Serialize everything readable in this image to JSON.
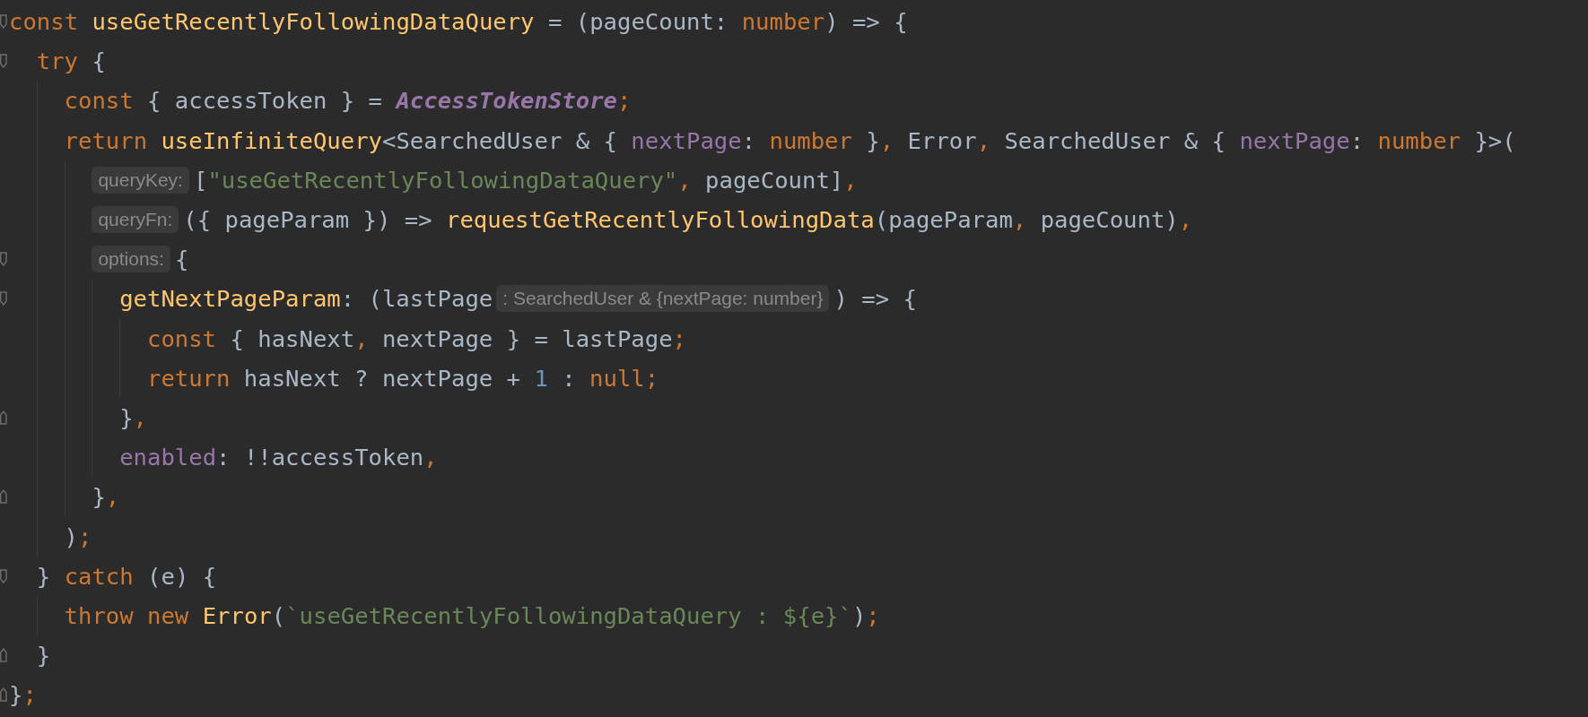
{
  "editor": {
    "lines": [
      {
        "fold_start": true,
        "tokens": [
          {
            "kind": "keyword",
            "text": "const "
          },
          {
            "kind": "function",
            "text": "useGetRecentlyFollowingDataQuery"
          },
          {
            "kind": "plain",
            "text": " = (pageCount: "
          },
          {
            "kind": "keyword",
            "text": "number"
          },
          {
            "kind": "plain",
            "text": ") => {"
          }
        ],
        "children": [
          {
            "fold_start": true,
            "tokens": [
              {
                "kind": "keyword",
                "text": "try"
              },
              {
                "kind": "plain",
                "text": " {"
              }
            ],
            "children": [
              {
                "tokens": [
                  {
                    "kind": "keyword",
                    "text": "const"
                  },
                  {
                    "kind": "plain",
                    "text": " { accessToken } = "
                  },
                  {
                    "kind": "static",
                    "text": "AccessTokenStore"
                  },
                  {
                    "kind": "keyword",
                    "text": ";"
                  }
                ]
              },
              {
                "tokens": [
                  {
                    "kind": "keyword",
                    "text": "return"
                  },
                  {
                    "kind": "function",
                    "text": " useInfiniteQuery"
                  },
                  {
                    "kind": "plain",
                    "text": "<SearchedUser & { "
                  },
                  {
                    "kind": "property",
                    "text": "nextPage"
                  },
                  {
                    "kind": "plain",
                    "text": ": "
                  },
                  {
                    "kind": "keyword",
                    "text": "number"
                  },
                  {
                    "kind": "plain",
                    "text": " }"
                  },
                  {
                    "kind": "keyword",
                    "text": ","
                  },
                  {
                    "kind": "plain",
                    "text": " Error"
                  },
                  {
                    "kind": "keyword",
                    "text": ","
                  },
                  {
                    "kind": "plain",
                    "text": " SearchedUser & { "
                  },
                  {
                    "kind": "property",
                    "text": "nextPage"
                  },
                  {
                    "kind": "plain",
                    "text": ": "
                  },
                  {
                    "kind": "keyword",
                    "text": "number"
                  },
                  {
                    "kind": "plain",
                    "text": " }>("
                  }
                ],
                "children": [
                  {
                    "tokens": [
                      {
                        "kind": "hint",
                        "text": "queryKey:"
                      },
                      {
                        "kind": "plain",
                        "text": "["
                      },
                      {
                        "kind": "string",
                        "text": "\"useGetRecentlyFollowingDataQuery\""
                      },
                      {
                        "kind": "keyword",
                        "text": ","
                      },
                      {
                        "kind": "plain",
                        "text": " pageCount]"
                      },
                      {
                        "kind": "keyword",
                        "text": ","
                      }
                    ]
                  },
                  {
                    "tokens": [
                      {
                        "kind": "hint",
                        "text": "queryFn:"
                      },
                      {
                        "kind": "plain",
                        "text": "({ pageParam }) => "
                      },
                      {
                        "kind": "function",
                        "text": "requestGetRecentlyFollowingData"
                      },
                      {
                        "kind": "plain",
                        "text": "(pageParam"
                      },
                      {
                        "kind": "keyword",
                        "text": ","
                      },
                      {
                        "kind": "plain",
                        "text": " pageCount)"
                      },
                      {
                        "kind": "keyword",
                        "text": ","
                      }
                    ]
                  },
                  {
                    "fold_start": true,
                    "tokens": [
                      {
                        "kind": "hint",
                        "text": "options:"
                      },
                      {
                        "kind": "plain",
                        "text": "{"
                      }
                    ],
                    "children": [
                      {
                        "fold_start": true,
                        "tokens": [
                          {
                            "kind": "function",
                            "text": "getNextPageParam"
                          },
                          {
                            "kind": "plain",
                            "text": ": (lastPage"
                          },
                          {
                            "kind": "hint",
                            "text": ": SearchedUser & {nextPage: number}"
                          },
                          {
                            "kind": "plain",
                            "text": ") => {"
                          }
                        ],
                        "children": [
                          {
                            "tokens": [
                              {
                                "kind": "keyword",
                                "text": "const"
                              },
                              {
                                "kind": "plain",
                                "text": " { hasNext"
                              },
                              {
                                "kind": "keyword",
                                "text": ","
                              },
                              {
                                "kind": "plain",
                                "text": " nextPage } = lastPage"
                              },
                              {
                                "kind": "keyword",
                                "text": ";"
                              }
                            ]
                          },
                          {
                            "tokens": [
                              {
                                "kind": "keyword",
                                "text": "return"
                              },
                              {
                                "kind": "plain",
                                "text": " hasNext ? nextPage + "
                              },
                              {
                                "kind": "number",
                                "text": "1"
                              },
                              {
                                "kind": "plain",
                                "text": " : "
                              },
                              {
                                "kind": "keyword",
                                "text": "null;"
                              }
                            ]
                          }
                        ]
                      },
                      {
                        "fold_end": true,
                        "tokens": [
                          {
                            "kind": "plain",
                            "text": "}"
                          },
                          {
                            "kind": "keyword",
                            "text": ","
                          }
                        ]
                      },
                      {
                        "tokens": [
                          {
                            "kind": "property",
                            "text": "enabled"
                          },
                          {
                            "kind": "plain",
                            "text": ": !!accessToken"
                          },
                          {
                            "kind": "keyword",
                            "text": ","
                          }
                        ]
                      }
                    ]
                  },
                  {
                    "fold_end": true,
                    "tokens": [
                      {
                        "kind": "plain",
                        "text": "}"
                      },
                      {
                        "kind": "keyword",
                        "text": ","
                      }
                    ]
                  }
                ]
              },
              {
                "tokens": [
                  {
                    "kind": "plain",
                    "text": ")"
                  },
                  {
                    "kind": "keyword",
                    "text": ";"
                  }
                ]
              }
            ]
          },
          {
            "fold_start": true,
            "tokens": [
              {
                "kind": "plain",
                "text": "} "
              },
              {
                "kind": "keyword",
                "text": "catch"
              },
              {
                "kind": "plain",
                "text": " (e) {"
              }
            ],
            "children": [
              {
                "tokens": [
                  {
                    "kind": "keyword",
                    "text": "throw new"
                  },
                  {
                    "kind": "function",
                    "text": " Error"
                  },
                  {
                    "kind": "plain",
                    "text": "("
                  },
                  {
                    "kind": "string",
                    "text": "`useGetRecentlyFollowingDataQuery : ${e}`"
                  },
                  {
                    "kind": "plain",
                    "text": ")"
                  },
                  {
                    "kind": "keyword",
                    "text": ";"
                  }
                ]
              }
            ]
          },
          {
            "fold_end": true,
            "tokens": [
              {
                "kind": "plain",
                "text": "}"
              }
            ]
          }
        ]
      },
      {
        "fold_end": true,
        "tokens": [
          {
            "kind": "plain",
            "text": "}"
          },
          {
            "kind": "keyword",
            "text": ";"
          }
        ]
      }
    ]
  }
}
